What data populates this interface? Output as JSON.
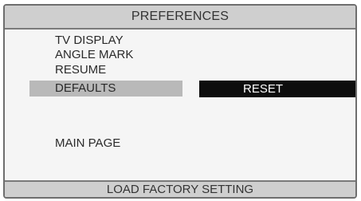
{
  "header": {
    "title": "PREFERENCES"
  },
  "menu": {
    "items": [
      {
        "label": "TV DISPLAY"
      },
      {
        "label": "ANGLE MARK"
      },
      {
        "label": "RESUME"
      },
      {
        "label": "DEFAULTS",
        "selected": true
      },
      {
        "label": "MAIN PAGE"
      }
    ]
  },
  "submenu": {
    "option": "RESET"
  },
  "footer": {
    "hint": "LOAD FACTORY SETTING"
  },
  "colors": {
    "bar_background": "#cfcfcf",
    "selection_highlight": "#b9b9b9",
    "active_option_background": "#0d0d0d",
    "active_option_text": "#ffffff"
  }
}
